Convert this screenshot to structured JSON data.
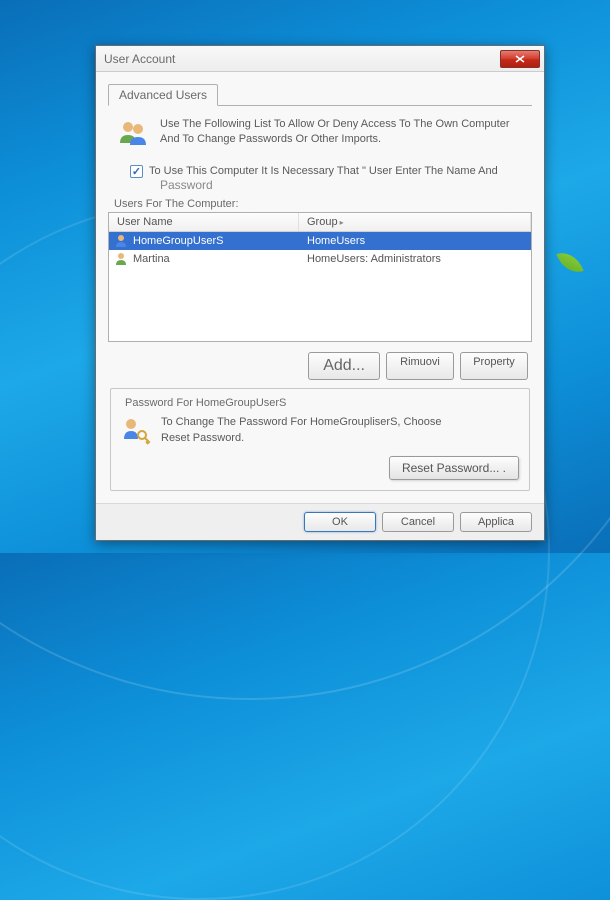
{
  "title": "User Account",
  "tab_label": "Advanced Users",
  "intro_text": "Use The Following List To Allow Or Deny Access To The Own Computer And To Change Passwords Or Other Imports.",
  "checkbox_text": "To Use This Computer It Is Necessary That \" User Enter The Name And",
  "password_sub": "Password",
  "list_label": "Users For The Computer:",
  "columns": {
    "user": "User Name",
    "group": "Group"
  },
  "rows": [
    {
      "user": "HomeGroupUserS",
      "group": "HomeUsers",
      "selected": true
    },
    {
      "user": "Martina",
      "group": "HomeUsers: Administrators",
      "selected": false
    }
  ],
  "buttons": {
    "add": "Add...",
    "remove": "Rimuovi",
    "properties": "Property"
  },
  "fieldset_legend": "Password For HomeGroupUserS",
  "reset_text_line1": "To Change The Password For HomeGroupliserS, Choose",
  "reset_text_line2": "Reset Password.",
  "reset_button": "Reset Password... .",
  "footer": {
    "ok": "OK",
    "cancel": "Cancel",
    "apply": "Applica"
  }
}
